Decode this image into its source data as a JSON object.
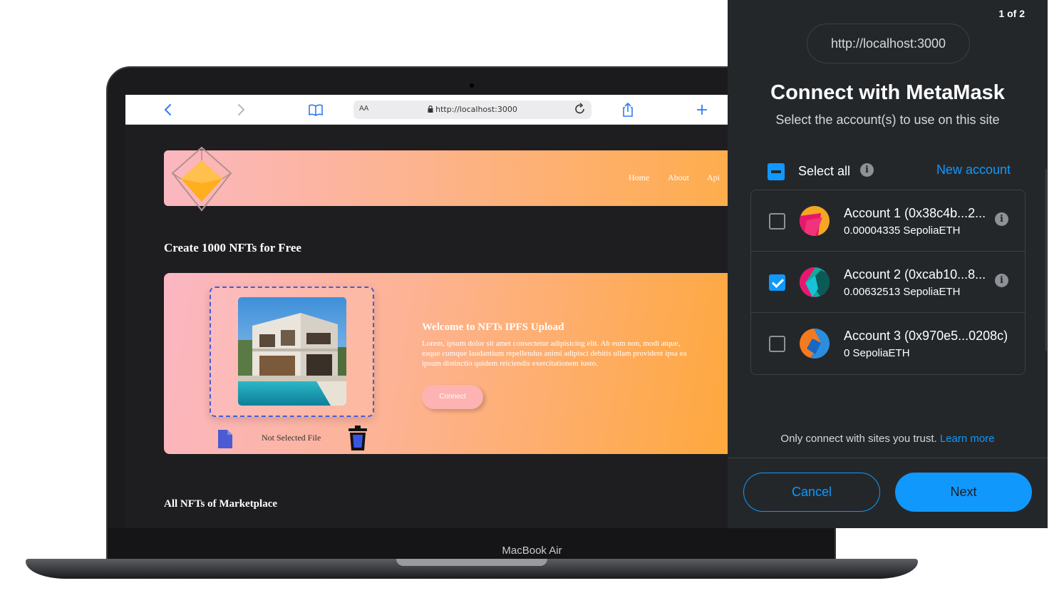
{
  "laptop": {
    "model_label": "MacBook Air"
  },
  "browser": {
    "url_text_size": "AA",
    "url": "http://localhost:3000",
    "icons": {
      "back": "chevron-left-icon",
      "forward": "chevron-right-icon",
      "bookmarks": "book-icon",
      "lock": "lock-icon",
      "reload": "reload-icon",
      "share": "share-icon",
      "new_tab": "plus-icon"
    }
  },
  "site": {
    "nav": [
      "Home",
      "About",
      "Api"
    ],
    "heading": "Create 1000 NFTs for Free",
    "upload": {
      "file_label": "Not Selected File",
      "welcome_title": "Welcome to NFTs IPFS Upload",
      "welcome_body": "Lorem, ipsum dolor sit amet consectetur adipisicing elit. Ab eum non, modi atque, eaque cumque laudantium repellendus animi adipisci debitis ullam provident ipsa ea ipsum distinctio quidem reiciendis exercitationem iusto.",
      "connect_label": "Connect"
    },
    "marketplace_heading": "All NFTs of Marketplace",
    "colors": {
      "gradient_start": "#fbb7c0",
      "gradient_end": "#ffaa33",
      "accent": "#4a5bd3"
    }
  },
  "metamask": {
    "page_indicator": "1 of 2",
    "origin": "http://localhost:3000",
    "title": "Connect with MetaMask",
    "subtitle": "Select the account(s) to use on this site",
    "select_all_label": "Select all",
    "new_account_label": "New account",
    "accounts": [
      {
        "name": "Account 1 (0x38c4b...2...",
        "balance": "0.00004335 SepoliaETH",
        "checked": false,
        "has_info": true
      },
      {
        "name": "Account 2 (0xcab10...8...",
        "balance": "0.00632513 SepoliaETH",
        "checked": true,
        "has_info": true
      },
      {
        "name": "Account 3 (0x970e5...0208c)",
        "balance": "0 SepoliaETH",
        "checked": false,
        "has_info": false
      }
    ],
    "trust_text": "Only connect with sites you trust.",
    "learn_more_label": "Learn more",
    "cancel_label": "Cancel",
    "next_label": "Next",
    "colors": {
      "background": "#24272a",
      "primary": "#1098fc"
    }
  }
}
